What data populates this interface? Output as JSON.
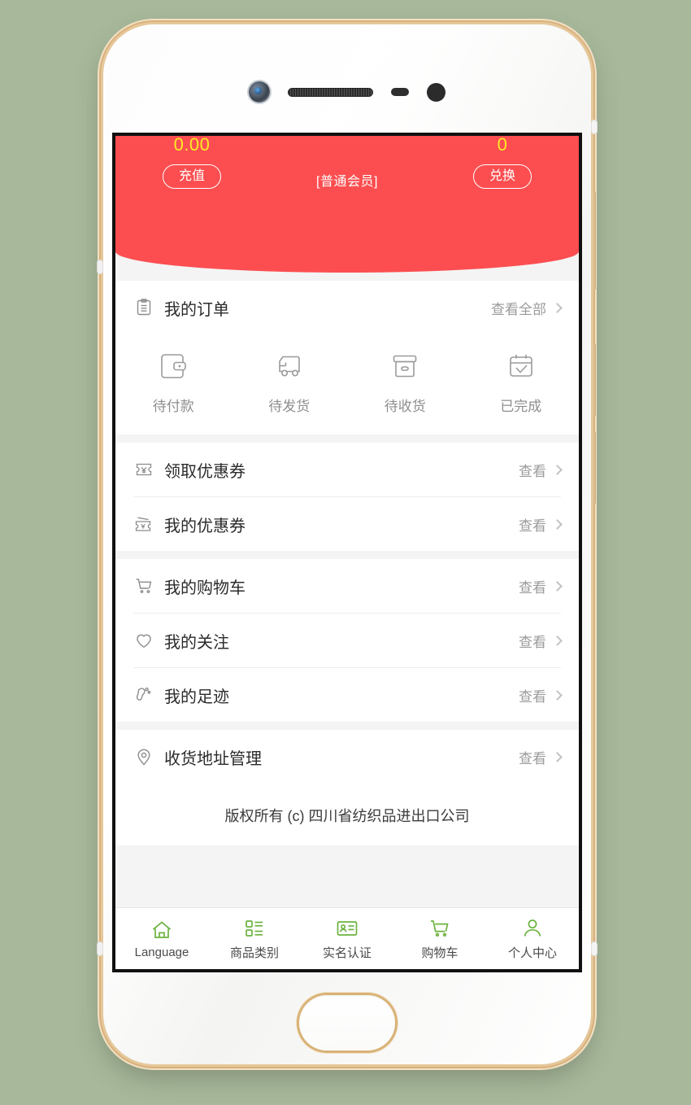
{
  "page": {
    "background_color": "#a8b99b",
    "device": "white smartphone with gold rim, front camera, earpiece speaker, home button"
  },
  "header": {
    "background_color": "#fc4e50",
    "value_color": "#ffe927",
    "balance": {
      "value": "0.00",
      "button_label": "充值"
    },
    "points": {
      "value": "0",
      "button_label": "兑换"
    },
    "member_tag": "[普通会员]"
  },
  "orders": {
    "icon": "clipboard-icon",
    "title": "我的订单",
    "view_all_label": "查看全部",
    "statuses": [
      {
        "icon": "wallet-icon",
        "label": "待付款"
      },
      {
        "icon": "truck-icon",
        "label": "待发货"
      },
      {
        "icon": "box-icon",
        "label": "待收货"
      },
      {
        "icon": "calendar-check-icon",
        "label": "已完成"
      }
    ]
  },
  "groups": [
    {
      "rows": [
        {
          "icon": "coupon-get-icon",
          "label": "领取优惠券",
          "action": "查看"
        },
        {
          "icon": "coupon-mine-icon",
          "label": "我的优惠券",
          "action": "查看"
        }
      ]
    },
    {
      "rows": [
        {
          "icon": "cart-icon",
          "label": "我的购物车",
          "action": "查看"
        },
        {
          "icon": "heart-icon",
          "label": "我的关注",
          "action": "查看"
        },
        {
          "icon": "footprint-icon",
          "label": "我的足迹",
          "action": "查看"
        }
      ]
    },
    {
      "rows": [
        {
          "icon": "location-pin-icon",
          "label": "收货地址管理",
          "action": "查看"
        }
      ]
    }
  ],
  "footer": {
    "copyright": "版权所有 (c) 四川省纺织品进出口公司"
  },
  "tabbar": {
    "accent_color": "#6cb33f",
    "items": [
      {
        "icon": "home-icon",
        "label": "Language"
      },
      {
        "icon": "category-icon",
        "label": "商品类别"
      },
      {
        "icon": "id-card-icon",
        "label": "实名认证"
      },
      {
        "icon": "cart-tab-icon",
        "label": "购物车"
      },
      {
        "icon": "person-icon",
        "label": "个人中心"
      }
    ]
  }
}
